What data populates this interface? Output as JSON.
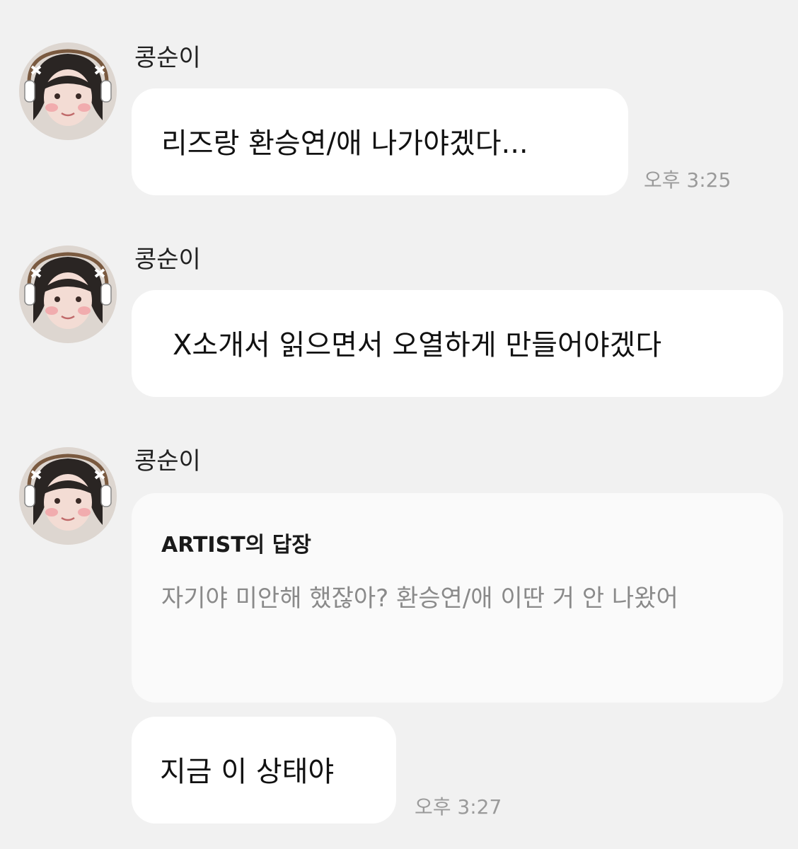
{
  "messages": [
    {
      "sender": "콩순이",
      "text": "리즈랑 환승연/애 나가야겠다...",
      "time": "오후 3:25"
    },
    {
      "sender": "콩순이",
      "text": "X소개서 읽으면서 오열하게 만들어야겠다"
    },
    {
      "sender": "콩순이",
      "reply": {
        "title": "ARTIST의 답장",
        "body": "자기야 미안해 했잖아? 환승연/애 이딴 거 안 나왔어"
      },
      "text": "지금 이 상태야",
      "time": "오후 3:27"
    }
  ],
  "icons": {
    "avatar": "avatar-icon"
  }
}
